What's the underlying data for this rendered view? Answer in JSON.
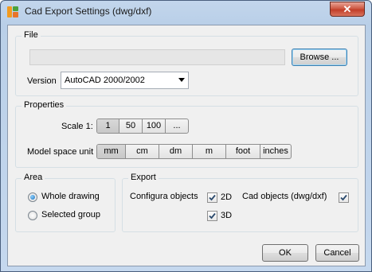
{
  "window": {
    "title": "Cad Export Settings (dwg/dxf)",
    "close_label": "✕"
  },
  "file": {
    "legend": "File",
    "path_value": "",
    "browse_label": "Browse ...",
    "version_label": "Version",
    "version_selected": "AutoCAD 2000/2002"
  },
  "properties": {
    "legend": "Properties",
    "scale_label": "Scale 1:",
    "scale_options": [
      "1",
      "50",
      "100",
      "..."
    ],
    "scale_selected": "1",
    "unit_label": "Model space unit",
    "unit_options": [
      "mm",
      "cm",
      "dm",
      "m",
      "foot",
      "inches"
    ],
    "unit_selected": "mm"
  },
  "area": {
    "legend": "Area",
    "options": [
      "Whole drawing",
      "Selected group"
    ],
    "selected": "Whole drawing"
  },
  "export": {
    "legend": "Export",
    "configura_label": "Configura objects",
    "check_2d_label": "2D",
    "check_2d_checked": true,
    "check_3d_label": "3D",
    "check_3d_checked": true,
    "cad_objects_label": "Cad objects (dwg/dxf)",
    "cad_objects_checked": true
  },
  "footer": {
    "ok_label": "OK",
    "cancel_label": "Cancel"
  },
  "colors": {
    "titlebar": "#c3d6ec",
    "client_bg": "#f0f0f0",
    "close_button": "#c23e29",
    "app_icon_orange": "#f29a1f",
    "app_icon_green": "#4ba23c"
  }
}
